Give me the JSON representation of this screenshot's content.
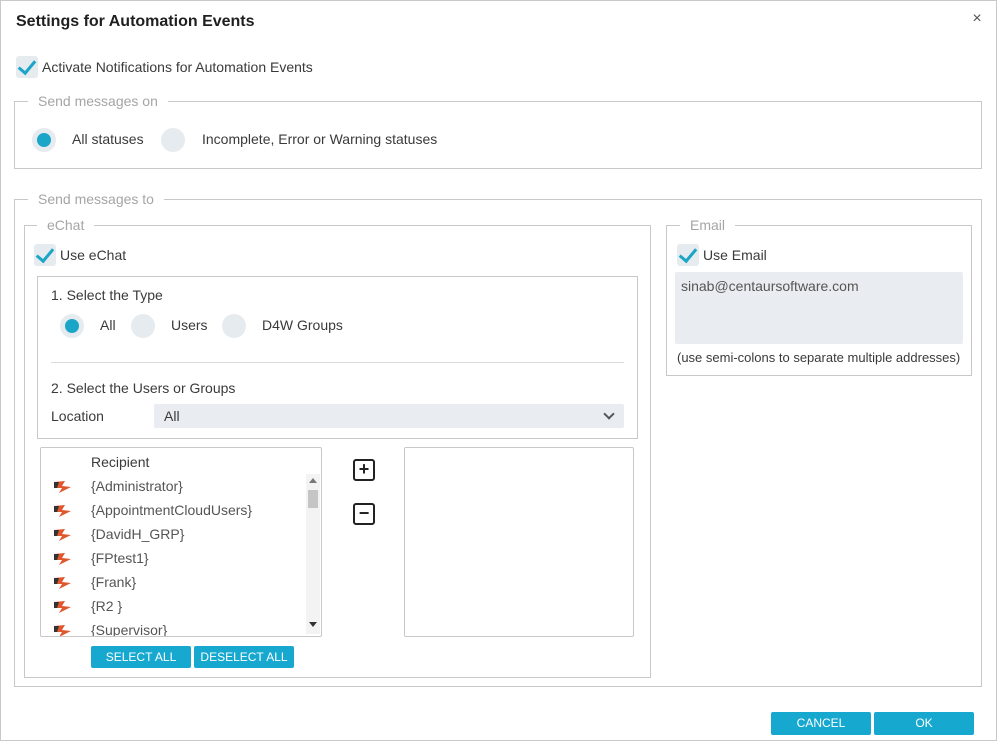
{
  "dialog": {
    "title": "Settings for Automation Events",
    "close_glyph": "×"
  },
  "activate": {
    "label": "Activate Notifications for Automation Events",
    "checked": true
  },
  "send_on": {
    "legend": "Send messages on",
    "options": [
      {
        "label": "All statuses",
        "selected": true
      },
      {
        "label": "Incomplete, Error or Warning statuses",
        "selected": false
      }
    ]
  },
  "send_to": {
    "legend": "Send messages to"
  },
  "echat": {
    "legend": "eChat",
    "use_label": "Use eChat",
    "use_checked": true,
    "step1_label": "1. Select the Type",
    "types": [
      {
        "label": "All",
        "selected": true
      },
      {
        "label": "Users",
        "selected": false
      },
      {
        "label": "D4W Groups",
        "selected": false
      }
    ],
    "step2_label": "2. Select the Users or Groups",
    "location_label": "Location",
    "location_value": "All",
    "recipient_header": "Recipient",
    "recipients": [
      "{Administrator}",
      "{AppointmentCloudUsers}",
      "{DavidH_GRP}",
      "{FPtest1}",
      "{Frank}",
      "{R2 }",
      "{Supervisor}"
    ],
    "add_glyph": "+",
    "remove_glyph": "−",
    "select_all": "SELECT ALL",
    "deselect_all": "DESELECT ALL"
  },
  "email": {
    "legend": "Email",
    "use_label": "Use Email",
    "use_checked": true,
    "address": "sinab@centaursoftware.com",
    "hint": "(use semi-colons to separate multiple addresses)"
  },
  "footer": {
    "cancel": "CANCEL",
    "ok": "OK"
  },
  "colors": {
    "accent": "#1ba5c6",
    "button": "#17a8cf",
    "field_bg": "#e9edf1"
  }
}
